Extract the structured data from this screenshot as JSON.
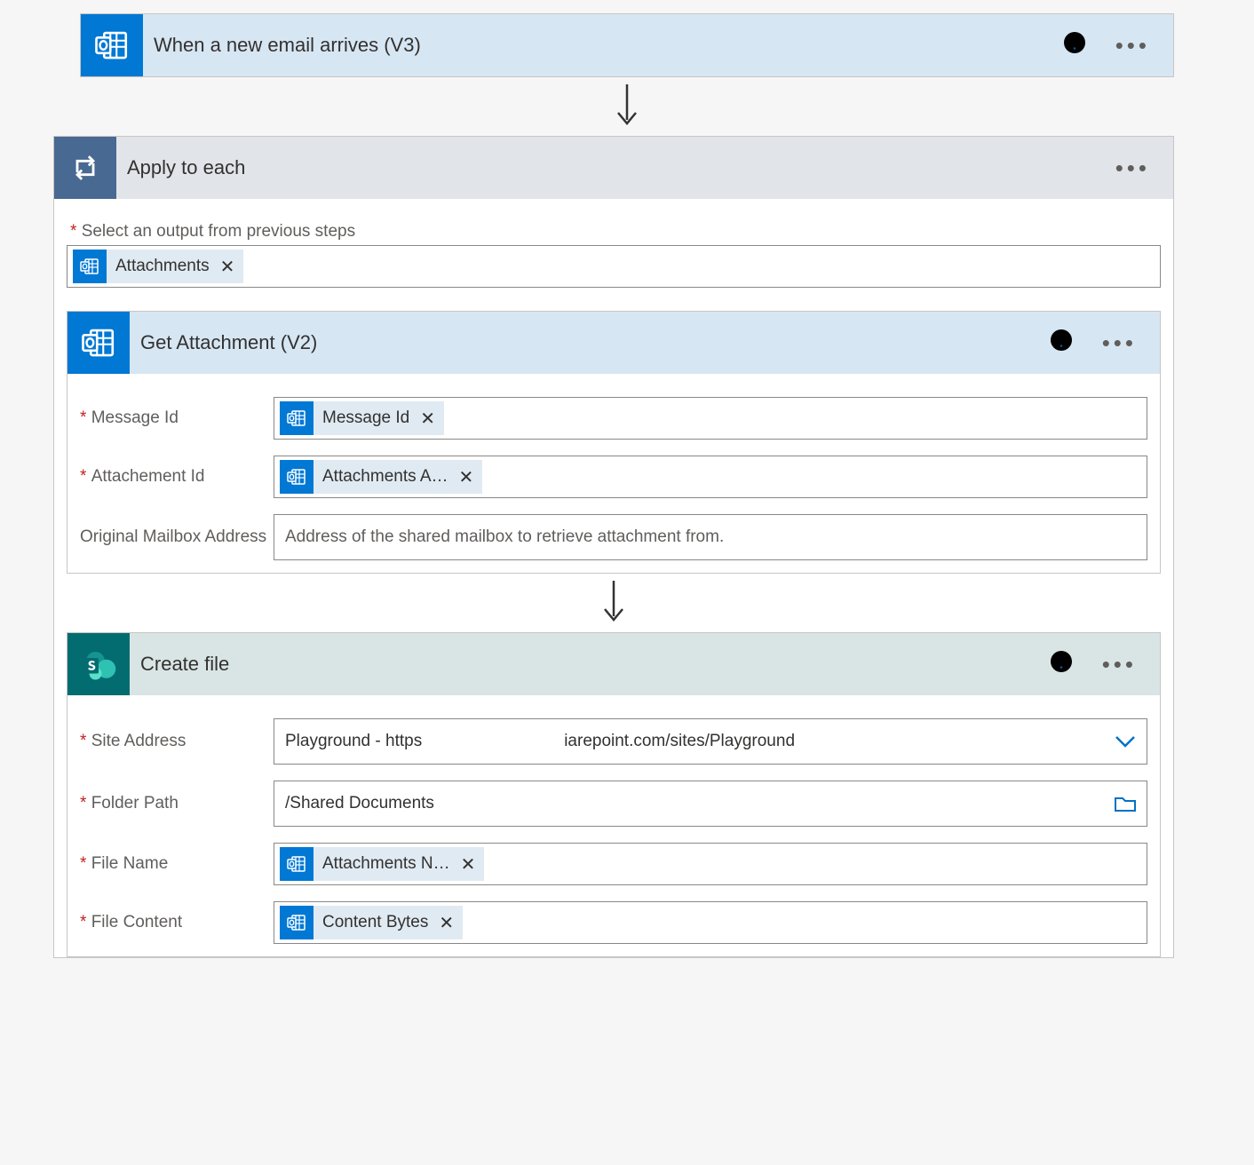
{
  "trigger": {
    "title": "When a new email arrives (V3)"
  },
  "applyToEach": {
    "title": "Apply to each",
    "select_output_label": "Select an output from previous steps",
    "token_attachments": "Attachments"
  },
  "getAttachment": {
    "title": "Get Attachment (V2)",
    "parameters": {
      "message_id": {
        "label": "Message Id",
        "token": "Message Id"
      },
      "attachment_id": {
        "label": "Attachement Id",
        "token": "Attachments A…"
      },
      "mailbox": {
        "label": "Original Mailbox Address",
        "placeholder": "Address of the shared mailbox to retrieve attachment from."
      }
    }
  },
  "createFile": {
    "title": "Create file",
    "parameters": {
      "site_address": {
        "label": "Site Address",
        "value_prefix": "Playground - https",
        "value_suffix": "iarepoint.com/sites/Playground"
      },
      "folder_path": {
        "label": "Folder Path",
        "value": "/Shared Documents"
      },
      "file_name": {
        "label": "File Name",
        "token": "Attachments N…"
      },
      "file_content": {
        "label": "File Content",
        "token": "Content Bytes"
      }
    }
  }
}
